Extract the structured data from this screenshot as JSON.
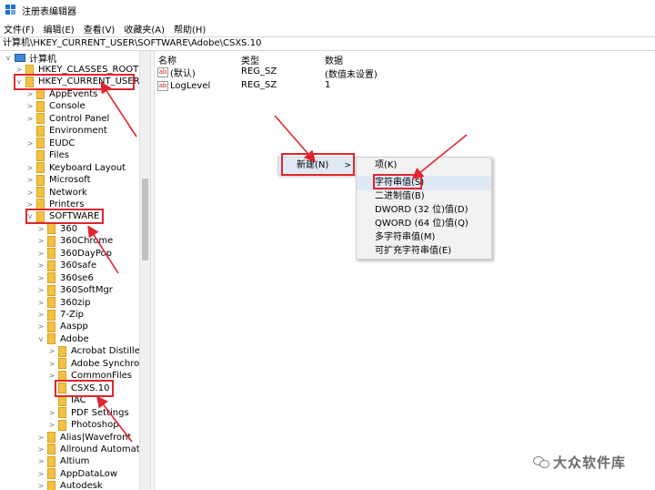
{
  "window": {
    "title": "注册表编辑器"
  },
  "menu": [
    "文件(F)",
    "编辑(E)",
    "查看(V)",
    "收藏夹(A)",
    "帮助(H)"
  ],
  "address": "计算机\\HKEY_CURRENT_USER\\SOFTWARE\\Adobe\\CSXS.10",
  "tree": {
    "root": "计算机",
    "nodes": [
      {
        "label": "HKEY_CLASSES_ROOT",
        "arrow": ">"
      },
      {
        "label": "HKEY_CURRENT_USER",
        "arrow": "v"
      },
      {
        "label": "AppEvents",
        "arrow": ">"
      },
      {
        "label": "Console",
        "arrow": ">"
      },
      {
        "label": "Control Panel",
        "arrow": ">"
      },
      {
        "label": "Environment",
        "arrow": ""
      },
      {
        "label": "EUDC",
        "arrow": ">"
      },
      {
        "label": "Files",
        "arrow": ""
      },
      {
        "label": "Keyboard Layout",
        "arrow": ">"
      },
      {
        "label": "Microsoft",
        "arrow": ">"
      },
      {
        "label": "Network",
        "arrow": ">"
      },
      {
        "label": "Printers",
        "arrow": ">"
      },
      {
        "label": "SOFTWARE",
        "arrow": "v"
      },
      {
        "label": "360",
        "arrow": ">"
      },
      {
        "label": "360Chrome",
        "arrow": ">"
      },
      {
        "label": "360DayPop",
        "arrow": ">"
      },
      {
        "label": "360safe",
        "arrow": ">"
      },
      {
        "label": "360se6",
        "arrow": ">"
      },
      {
        "label": "360SoftMgr",
        "arrow": ">"
      },
      {
        "label": "360zip",
        "arrow": ">"
      },
      {
        "label": "7-Zip",
        "arrow": ">"
      },
      {
        "label": "Aaspp",
        "arrow": ">"
      },
      {
        "label": "Adobe",
        "arrow": "v"
      },
      {
        "label": "Acrobat Distiller",
        "arrow": ">"
      },
      {
        "label": "Adobe Synchron",
        "arrow": ">"
      },
      {
        "label": "CommonFiles",
        "arrow": ">"
      },
      {
        "label": "CSXS.10",
        "arrow": ""
      },
      {
        "label": "IAC",
        "arrow": ""
      },
      {
        "label": "PDF Settings",
        "arrow": ">"
      },
      {
        "label": "Photoshop",
        "arrow": ">"
      },
      {
        "label": "Alias|Wavefront",
        "arrow": ">"
      },
      {
        "label": "Allround Automatio",
        "arrow": ">"
      },
      {
        "label": "Altium",
        "arrow": ">"
      },
      {
        "label": "AppDataLow",
        "arrow": ">"
      },
      {
        "label": "Autodesk",
        "arrow": ">"
      }
    ]
  },
  "list": {
    "headers": {
      "name": "名称",
      "type": "类型",
      "data": "数据"
    },
    "rows": [
      {
        "icon": "ab",
        "name": "(默认)",
        "type": "REG_SZ",
        "data": "(数值未设置)"
      },
      {
        "icon": "ab",
        "name": "LogLevel",
        "type": "REG_SZ",
        "data": "1"
      }
    ]
  },
  "context_menu": {
    "new_label": "新建(N)",
    "sub_arrow": ">"
  },
  "submenu": [
    "项(K)",
    "字符串值(S)",
    "二进制值(B)",
    "DWORD (32 位)值(D)",
    "QWORD (64 位)值(Q)",
    "多字符串值(M)",
    "可扩充字符串值(E)"
  ],
  "watermark": "大众软件库",
  "colors": {
    "highlight_box": "#e0262e",
    "menu_hover": "#dfe9f6",
    "folder": "#f3c244"
  }
}
